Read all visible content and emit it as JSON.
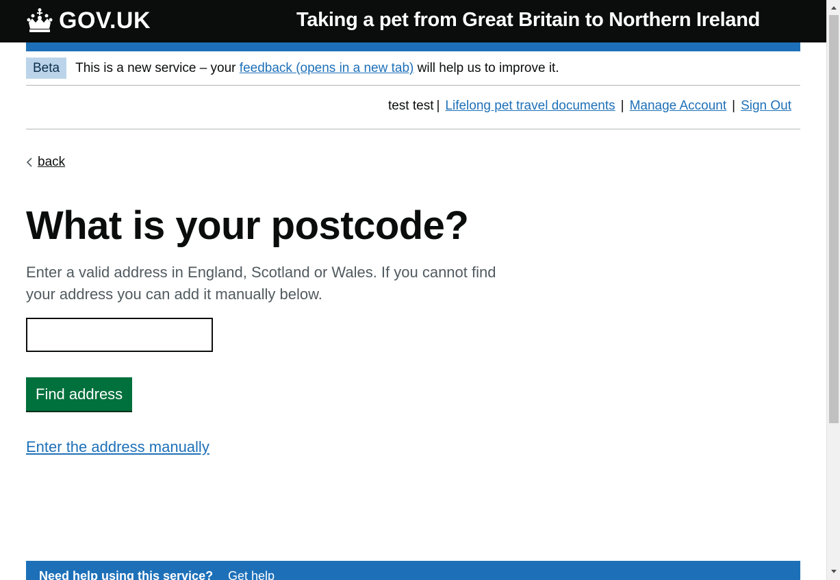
{
  "header": {
    "logo_text": "GOV.UK",
    "service_name": "Taking a pet from Great Britain to Northern Ireland"
  },
  "phase_banner": {
    "tag": "Beta",
    "text_before": "This is a new service – your ",
    "link": "feedback (opens in a new tab)",
    "text_after": " will help us to improve it."
  },
  "account_nav": {
    "user": "test test",
    "sep": "|",
    "links": [
      "Lifelong pet travel documents ",
      "Manage Account ",
      "Sign Out"
    ]
  },
  "back_link": "back",
  "page": {
    "heading": "What is your postcode?",
    "hint": "Enter a valid address in England, Scotland or Wales. If you cannot find your address you can add it manually below.",
    "postcode_value": "",
    "find_button": "Find address",
    "manual_link": "Enter the address manually"
  },
  "help_bar": {
    "title": "Need help using this service?",
    "link": "Get help"
  },
  "colors": {
    "header_bg": "#0b0c0c",
    "brand_blue": "#1d70b8",
    "button_green": "#00703c",
    "beta_tag": "#bbd4ea"
  }
}
